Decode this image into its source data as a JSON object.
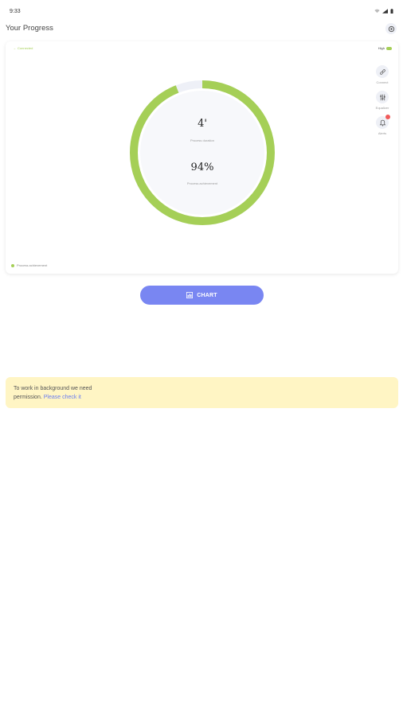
{
  "status_bar": {
    "time": "9:33"
  },
  "header": {
    "title": "Your Progress"
  },
  "card": {
    "status_tag": "Connected",
    "level_label": "High",
    "progress_fraction": 0.94,
    "time_value": "4'",
    "time_label": "Process duration",
    "percent_value": "94%",
    "percent_label": "Process achievement",
    "side_actions": [
      {
        "label": "Connect",
        "icon": "link-icon"
      },
      {
        "label": "Equalizer",
        "icon": "equalizer-icon"
      },
      {
        "label": "Alerts",
        "icon": "bell-icon"
      }
    ],
    "legend_label": "Process achievement",
    "colors": {
      "accent": "#a5cf57",
      "track": "#eef0f7"
    }
  },
  "chart_button": {
    "label": "CHART",
    "color": "#7986f2"
  },
  "notice": {
    "text_line1": "To work in background we need",
    "text_line2": "permission.",
    "link": "Please check it",
    "background": "#fff5c4"
  }
}
